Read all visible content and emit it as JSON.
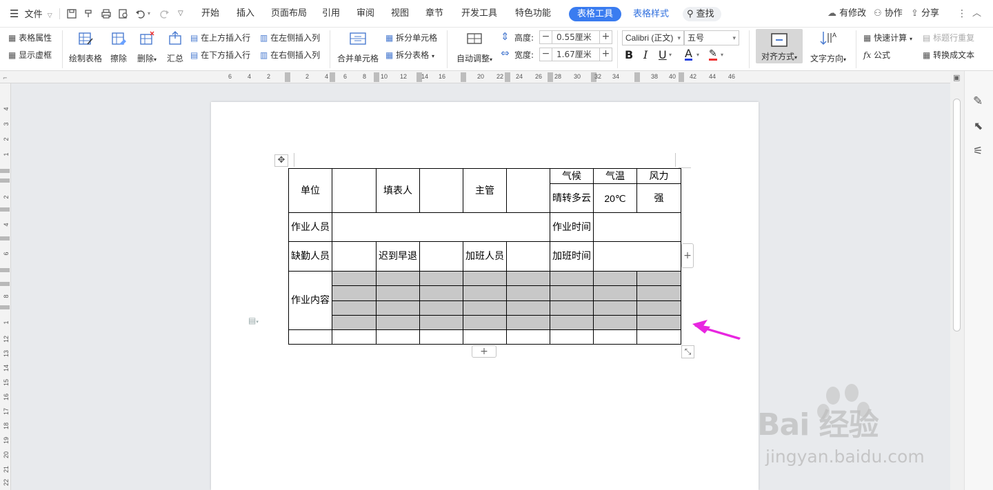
{
  "menubar": {
    "file": "文件",
    "tabs": [
      "开始",
      "插入",
      "页面布局",
      "引用",
      "审阅",
      "视图",
      "章节",
      "开发工具",
      "特色功能"
    ],
    "active_tab": "表格工具",
    "style_tab": "表格样式",
    "search": "查找",
    "modified": "有修改",
    "collab": "协作",
    "share": "分享"
  },
  "ribbon": {
    "table_props": "表格属性",
    "show_grid": "显示虚框",
    "draw_table": "绘制表格",
    "erase": "擦除",
    "delete": "删除",
    "summary": "汇总",
    "ins_above": "在上方插入行",
    "ins_below": "在下方插入行",
    "ins_left": "在左侧插入列",
    "ins_right": "在右侧插入列",
    "merge": "合并单元格",
    "split_cell": "拆分单元格",
    "split_table": "拆分表格",
    "autofit": "自动调整",
    "height_label": "高度:",
    "height_val": "0.55厘米",
    "width_label": "宽度:",
    "width_val": "1.67厘米",
    "font": "Calibri (正文)",
    "size": "五号",
    "align": "对齐方式",
    "text_dir": "文字方向",
    "quick_calc": "快速计算",
    "title_repeat": "标题行重复",
    "formula": "公式",
    "to_text": "转换成文本"
  },
  "ruler": {
    "h_ticks": [
      "6",
      "4",
      "2",
      "2",
      "4",
      "6",
      "8",
      "10",
      "12",
      "14",
      "16",
      "20",
      "22",
      "24",
      "26",
      "28",
      "30",
      "32",
      "34",
      "38",
      "40",
      "42",
      "44",
      "46"
    ],
    "v_ticks": [
      "4",
      "3",
      "2",
      "1",
      "2",
      "4",
      "6",
      "8",
      "1",
      "12",
      "13",
      "14",
      "15",
      "16",
      "17",
      "18",
      "19",
      "20",
      "21",
      "22"
    ]
  },
  "table": {
    "r0": {
      "unit": "单位",
      "filler": "填表人",
      "supervisor": "主管",
      "climate": "气候",
      "temp": "气温",
      "wind": "风力"
    },
    "r1": {
      "climate_val": "晴转多云",
      "temp_val": "20℃",
      "wind_val": "强"
    },
    "r2": {
      "workers": "作业人员",
      "work_time": "作业时间"
    },
    "r3": {
      "absent": "缺勤人员",
      "late": "迟到早退",
      "overtime_staff": "加班人员",
      "overtime_time": "加班时间"
    },
    "r4": {
      "content": "作业内容"
    }
  },
  "watermark": {
    "brand": "Bai 经验",
    "url": "jingyan.baidu.com"
  },
  "colors": {
    "accent": "#3a7cf0",
    "selection": "#c8c8c8",
    "arrow": "#e826e0"
  }
}
